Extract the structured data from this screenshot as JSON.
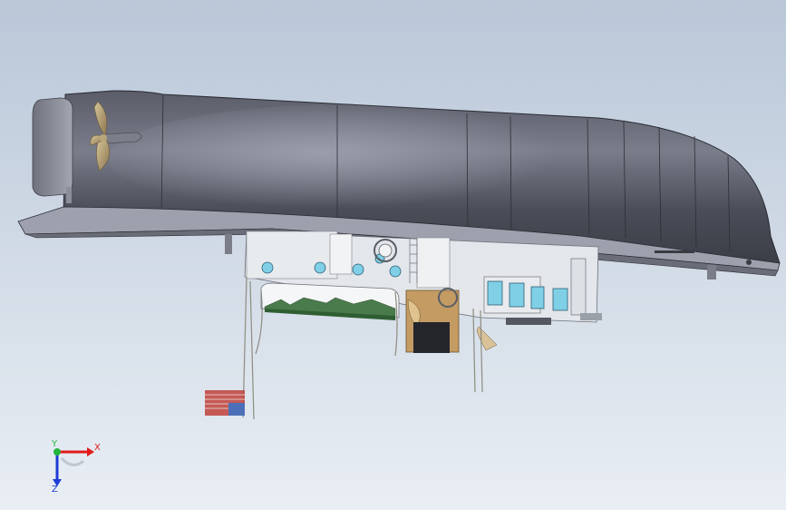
{
  "viewport": {
    "background_top": "#b9c7d8",
    "background_bottom": "#e9eef4"
  },
  "model": {
    "hull_color": "#4b4d58",
    "hull_highlight": "#7c7f8c",
    "deck_color": "#dfe2e6",
    "window_color": "#7fd0e6",
    "wood_color": "#b9915a"
  },
  "triad": {
    "x_label": "X",
    "y_label": "Y",
    "z_label": "Z",
    "x_color": "#e11b1b",
    "y_color": "#22b43c",
    "z_color": "#1d3bd6"
  }
}
